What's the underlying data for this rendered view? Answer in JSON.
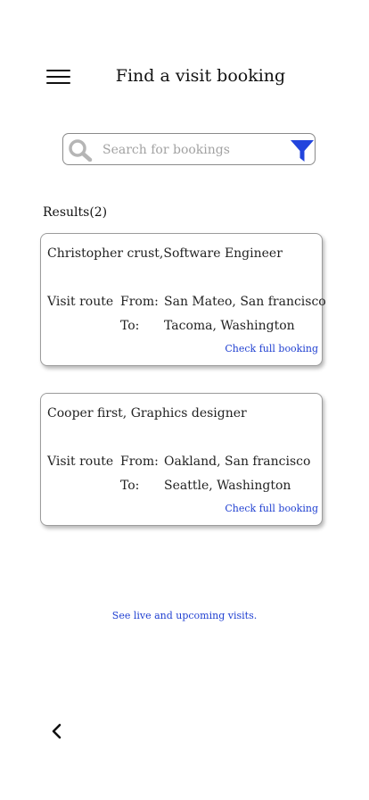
{
  "header": {
    "menu_icon": "hamburger-menu-icon",
    "title": "Find a visit booking"
  },
  "search": {
    "placeholder": "Search for bookings",
    "value": "",
    "search_icon": "magnifier-icon",
    "filter_icon": "funnel-filter-icon"
  },
  "results": {
    "label": "Results(2)",
    "items": [
      {
        "person": "Christopher crust,Software Engineer",
        "route_label": "Visit route",
        "from_label": "From:",
        "from": "San Mateo, San francisco",
        "to_label": "To:",
        "to": "Tacoma, Washington",
        "link": "Check full booking"
      },
      {
        "person": "Cooper first, Graphics designer",
        "route_label": "Visit route",
        "from_label": "From:",
        "from": "Oakland, San francisco",
        "to_label": "To:",
        "to": "Seattle, Washington",
        "link": "Check full booking"
      }
    ]
  },
  "footer": {
    "see_live": "See live and upcoming visits.",
    "back_icon": "chevron-left-icon"
  },
  "colors": {
    "link": "#1f3fd1",
    "filter_icon": "#2244dd",
    "search_icon": "#b5b5b5"
  }
}
